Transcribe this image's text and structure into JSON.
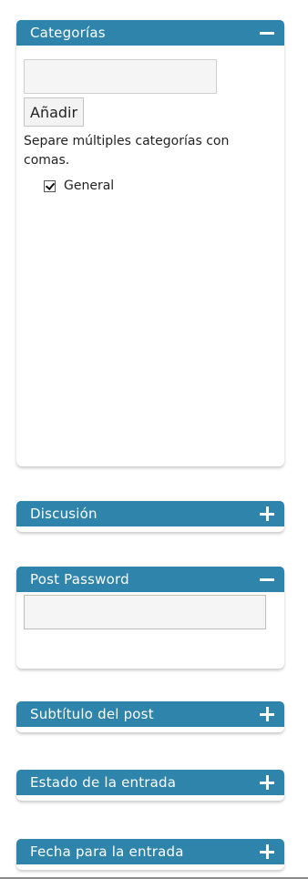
{
  "categories": {
    "title": "Categorías",
    "input_value": "",
    "add_label": "Añadir",
    "hint": "Separe múltiples categorías con comas.",
    "items": [
      {
        "label": "General",
        "checked": true
      }
    ]
  },
  "discussion": {
    "title": "Discusión"
  },
  "post_password": {
    "title": "Post Password",
    "input_value": ""
  },
  "subtitle": {
    "title": "Subtítulo del post"
  },
  "status": {
    "title": "Estado de la entrada"
  },
  "date": {
    "title": "Fecha para la entrada"
  },
  "colors": {
    "header": "#2e84ab",
    "header_text": "#ffffff"
  },
  "icons": {
    "collapse": "minus-icon",
    "expand": "plus-icon"
  }
}
